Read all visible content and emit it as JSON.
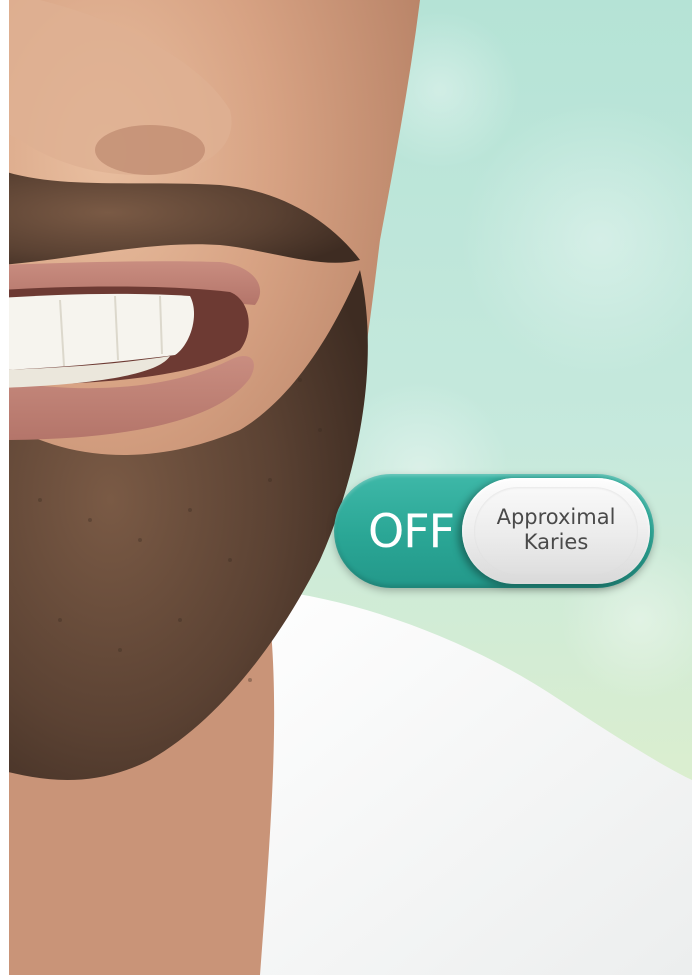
{
  "toggle": {
    "state_label": "OFF",
    "knob_line1": "Approximal",
    "knob_line2": "Karies",
    "is_on": false
  },
  "colors": {
    "track": "#2aa695",
    "knob": "#eeeeee",
    "knob_text": "#4a4a4a",
    "background_mint": "#c9e9df"
  }
}
